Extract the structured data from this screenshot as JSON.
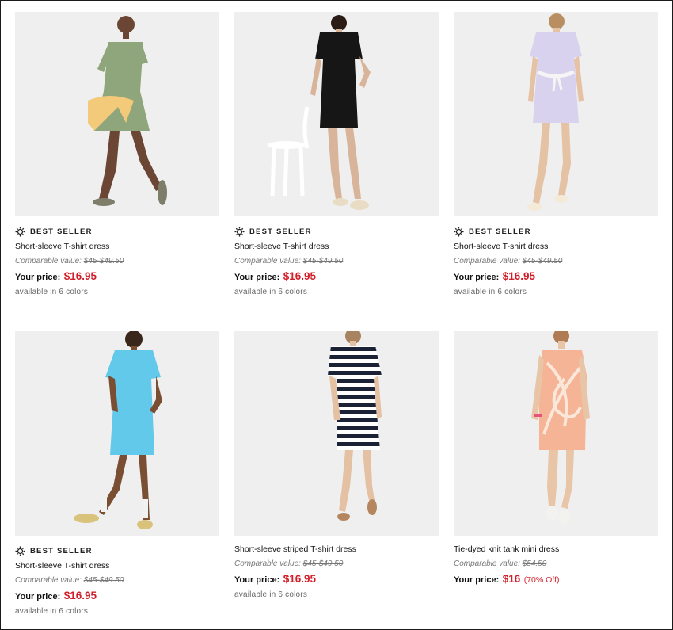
{
  "products": [
    {
      "badge": "BEST SELLER",
      "name": "Short-sleeve T-shirt dress",
      "comparable_label": "Comparable value:",
      "comparable_value": "$45-$49.50",
      "price_label": "Your price:",
      "price": "$16.95",
      "price_note": "",
      "colors": "available in 6 colors",
      "dress_color": "#8fa57b",
      "image_icon": "model-green-dress-image"
    },
    {
      "badge": "BEST SELLER",
      "name": "Short-sleeve T-shirt dress",
      "comparable_label": "Comparable value:",
      "comparable_value": "$45-$49.50",
      "price_label": "Your price:",
      "price": "$16.95",
      "price_note": "",
      "colors": "available in 6 colors",
      "dress_color": "#161616",
      "image_icon": "model-black-dress-image"
    },
    {
      "badge": "BEST SELLER",
      "name": "Short-sleeve T-shirt dress",
      "comparable_label": "Comparable value:",
      "comparable_value": "$45-$49.50",
      "price_label": "Your price:",
      "price": "$16.95",
      "price_note": "",
      "colors": "available in 6 colors",
      "dress_color": "#d9d2ee",
      "image_icon": "model-lavender-dress-image"
    },
    {
      "badge": "BEST SELLER",
      "name": "Short-sleeve T-shirt dress",
      "comparable_label": "Comparable value:",
      "comparable_value": "$45-$49.50",
      "price_label": "Your price:",
      "price": "$16.95",
      "price_note": "",
      "colors": "available in 6 colors",
      "dress_color": "#62c9ea",
      "image_icon": "model-blue-dress-image"
    },
    {
      "badge": "",
      "name": "Short-sleeve striped T-shirt dress",
      "comparable_label": "Comparable value:",
      "comparable_value": "$45-$49.50",
      "price_label": "Your price:",
      "price": "$16.95",
      "price_note": "",
      "colors": "available in 6 colors",
      "dress_color": "#1b2235",
      "image_icon": "model-striped-dress-image"
    },
    {
      "badge": "",
      "name": "Tie-dyed knit tank mini dress",
      "comparable_label": "Comparable value:",
      "comparable_value": "$54.50",
      "price_label": "Your price:",
      "price": "$16",
      "price_note": "(70% Off)",
      "colors": "",
      "dress_color": "#f4b495",
      "image_icon": "model-tie-dye-dress-image"
    }
  ],
  "theme": {
    "sale_red": "#d11f2a",
    "image_bg": "#efefef",
    "border": "#1a1a1a"
  }
}
